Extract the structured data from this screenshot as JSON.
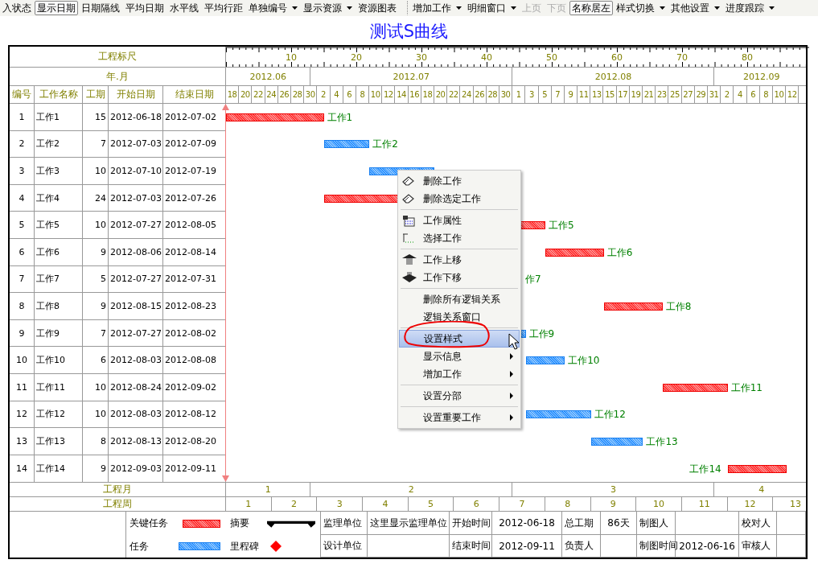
{
  "toolbar": [
    {
      "label": "入状态",
      "pressed": false,
      "dropdown": false,
      "disabled": false,
      "separator_before": false
    },
    {
      "label": "显示日期",
      "pressed": true,
      "dropdown": false,
      "disabled": false,
      "separator_before": false
    },
    {
      "label": "日期隔线",
      "pressed": false,
      "dropdown": false,
      "disabled": false,
      "separator_before": false
    },
    {
      "label": "平均日期",
      "pressed": false,
      "dropdown": false,
      "disabled": false,
      "separator_before": false
    },
    {
      "label": "水平线",
      "pressed": false,
      "dropdown": false,
      "disabled": false,
      "separator_before": false
    },
    {
      "label": "平均行距",
      "pressed": false,
      "dropdown": false,
      "disabled": false,
      "separator_before": false
    },
    {
      "label": "单独编号",
      "pressed": false,
      "dropdown": true,
      "disabled": false,
      "separator_before": false
    },
    {
      "label": "显示资源",
      "pressed": false,
      "dropdown": true,
      "disabled": false,
      "separator_before": false
    },
    {
      "label": "资源图表",
      "pressed": false,
      "dropdown": false,
      "disabled": false,
      "separator_before": false
    },
    {
      "label": "增加工作",
      "pressed": false,
      "dropdown": true,
      "disabled": false,
      "separator_before": true
    },
    {
      "label": "明细窗口",
      "pressed": false,
      "dropdown": true,
      "disabled": false,
      "separator_before": false
    },
    {
      "label": "上页",
      "pressed": false,
      "dropdown": false,
      "disabled": true,
      "separator_before": false
    },
    {
      "label": "下页",
      "pressed": false,
      "dropdown": false,
      "disabled": true,
      "separator_before": false
    },
    {
      "label": "名称居左",
      "pressed": true,
      "dropdown": false,
      "disabled": false,
      "separator_before": false
    },
    {
      "label": "样式切换",
      "pressed": false,
      "dropdown": true,
      "disabled": false,
      "separator_before": false
    },
    {
      "label": "其他设置",
      "pressed": false,
      "dropdown": true,
      "disabled": false,
      "separator_before": false
    },
    {
      "label": "进度跟踪",
      "pressed": false,
      "dropdown": true,
      "disabled": false,
      "separator_before": false
    }
  ],
  "title": "测试S曲线",
  "ruler": {
    "label": "工程标尺",
    "ticks": [
      "10",
      "20",
      "30",
      "40",
      "50",
      "60",
      "70",
      "80"
    ]
  },
  "months": {
    "label": "年.月",
    "items": [
      "2012.06",
      "2012.07",
      "2012.08",
      "2012.09"
    ]
  },
  "columns": [
    "编号",
    "工作名称",
    "工期",
    "开始日期",
    "结束日期"
  ],
  "days": [
    "18",
    "20",
    "22",
    "24",
    "26",
    "28",
    "30",
    "2",
    "4",
    "6",
    "8",
    "10",
    "12",
    "14",
    "16",
    "18",
    "20",
    "22",
    "24",
    "26",
    "28",
    "30",
    "1",
    "3",
    "5",
    "7",
    "9",
    "11",
    "13",
    "15",
    "17",
    "19",
    "21",
    "23",
    "25",
    "27",
    "29",
    "31",
    "2",
    "4",
    "6",
    "8",
    "10",
    "12"
  ],
  "rows": [
    {
      "no": "1",
      "name": "工作1",
      "duration": "15",
      "start": "2012-06-18",
      "end": "2012-07-02",
      "critical": true,
      "bar_label": "工作1",
      "label_left": false
    },
    {
      "no": "2",
      "name": "工作2",
      "duration": "7",
      "start": "2012-07-03",
      "end": "2012-07-09",
      "critical": false,
      "bar_label": "工作2",
      "label_left": false
    },
    {
      "no": "3",
      "name": "工作3",
      "duration": "10",
      "start": "2012-07-10",
      "end": "2012-07-19",
      "critical": false
    },
    {
      "no": "4",
      "name": "工作4",
      "duration": "24",
      "start": "2012-07-03",
      "end": "2012-07-26",
      "critical": true
    },
    {
      "no": "5",
      "name": "工作5",
      "duration": "10",
      "start": "2012-07-27",
      "end": "2012-08-05",
      "critical": true,
      "bar_label": "工作5",
      "label_left": false
    },
    {
      "no": "6",
      "name": "工作6",
      "duration": "9",
      "start": "2012-08-06",
      "end": "2012-08-14",
      "critical": true,
      "bar_label": "工作6",
      "label_left": false
    },
    {
      "no": "7",
      "name": "工作7",
      "duration": "5",
      "start": "2012-07-27",
      "end": "2012-07-31",
      "bar_label": "作7",
      "label_left": false
    },
    {
      "no": "8",
      "name": "工作8",
      "duration": "9",
      "start": "2012-08-15",
      "end": "2012-08-23",
      "critical": true,
      "bar_label": "工作8",
      "label_left": false
    },
    {
      "no": "9",
      "name": "工作9",
      "duration": "7",
      "start": "2012-07-27",
      "end": "2012-08-02",
      "critical": false,
      "bar_label": "工作9",
      "label_left": false
    },
    {
      "no": "10",
      "name": "工作10",
      "duration": "6",
      "start": "2012-08-03",
      "end": "2012-08-08",
      "critical": false,
      "bar_label": "工作10",
      "label_left": false
    },
    {
      "no": "11",
      "name": "工作11",
      "duration": "10",
      "start": "2012-08-24",
      "end": "2012-09-02",
      "critical": true,
      "bar_label": "工作11",
      "label_left": false
    },
    {
      "no": "12",
      "name": "工作12",
      "duration": "10",
      "start": "2012-08-03",
      "end": "2012-08-12",
      "critical": false,
      "bar_label": "工作12",
      "label_left": false
    },
    {
      "no": "13",
      "name": "工作13",
      "duration": "8",
      "start": "2012-08-13",
      "end": "2012-08-20",
      "critical": false,
      "bar_label": "工作13",
      "label_left": false
    },
    {
      "no": "14",
      "name": "工作14",
      "duration": "9",
      "start": "2012-09-03",
      "end": "2012-09-11",
      "critical": true,
      "bar_label": "工作14",
      "label_left": true
    }
  ],
  "project_months": {
    "label": "工程月",
    "items": [
      "1",
      "2",
      "3",
      "4"
    ]
  },
  "project_weeks": {
    "label": "工程周",
    "items": [
      "1",
      "2",
      "3",
      "4",
      "5",
      "6",
      "7",
      "8",
      "9",
      "10",
      "11",
      "12",
      "13"
    ]
  },
  "legend": [
    {
      "label": "关键任务",
      "kind": "critical"
    },
    {
      "label": "摘要",
      "kind": "summary"
    },
    {
      "label": "任务",
      "kind": "task"
    },
    {
      "label": "里程碑",
      "kind": "milestone"
    }
  ],
  "info_rows": [
    [
      {
        "label": "监理单位",
        "value": "这里显示监理单位"
      },
      {
        "label": "开始时间",
        "value": "2012-06-18"
      },
      {
        "label": "总工期",
        "value": "86天"
      },
      {
        "label": "制图人"
      },
      {
        "label": "校对人"
      }
    ],
    [
      {
        "label": "设计单位"
      },
      {
        "label": "结束时间",
        "value": "2012-09-11"
      },
      {
        "label": "负责人"
      },
      {
        "label": "制图时间",
        "value": "2012-06-16"
      },
      {
        "label": "审核人"
      }
    ]
  ],
  "context_menu": {
    "groups": [
      [
        {
          "label": "删除工作",
          "kind": "delete",
          "selected": false,
          "submenu": false
        },
        {
          "label": "删除选定工作",
          "kind": "delete",
          "selected": false,
          "submenu": false
        }
      ],
      [
        {
          "label": "工作属性",
          "kind": "properties",
          "selected": false,
          "submenu": false
        },
        {
          "label": "选择工作",
          "kind": "select",
          "selected": false,
          "submenu": false
        }
      ],
      [
        {
          "label": "工作上移",
          "kind": "move-up",
          "selected": false,
          "submenu": false
        },
        {
          "label": "工作下移",
          "kind": "move-down",
          "selected": false,
          "submenu": false
        }
      ],
      [
        {
          "label": "删除所有逻辑关系",
          "kind": "plain",
          "selected": false,
          "submenu": false
        },
        {
          "label": "逻辑关系窗口",
          "kind": "plain",
          "selected": false,
          "submenu": false
        }
      ],
      [
        {
          "label": "设置样式",
          "kind": "plain",
          "selected": true,
          "submenu": false
        },
        {
          "label": "显示信息",
          "kind": "plain",
          "selected": false,
          "submenu": true
        },
        {
          "label": "增加工作",
          "kind": "plain",
          "selected": false,
          "submenu": true
        }
      ],
      [
        {
          "label": "设置分部",
          "kind": "plain",
          "selected": false,
          "submenu": true
        }
      ],
      [
        {
          "label": "设置重要工作",
          "kind": "plain",
          "selected": false,
          "submenu": true
        }
      ]
    ]
  }
}
